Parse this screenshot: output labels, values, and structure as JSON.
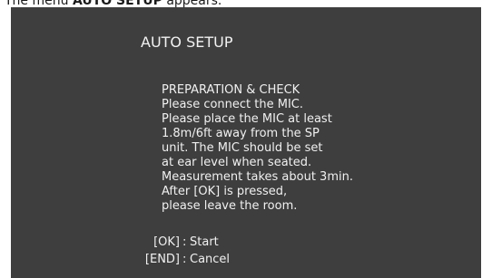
{
  "caption": {
    "prefix": "The menu ",
    "bold": "AUTO SETUP",
    "suffix": " appears."
  },
  "dialog": {
    "title": "AUTO SETUP",
    "lines": [
      "PREPARATION & CHECK",
      "Please connect the MIC.",
      "Please place the MIC at least",
      "1.8m/6ft away from the SP",
      "unit. The MIC should be set",
      "at ear level when seated.",
      "Measurement takes about 3min.",
      "After [OK] is pressed,",
      "please leave the room."
    ],
    "keys": [
      {
        "label": "[OK]",
        "sep": ":",
        "action": "Start"
      },
      {
        "label": "[END]",
        "sep": ":",
        "action": "Cancel"
      }
    ]
  },
  "colors": {
    "screen_bg": "#3e3e3e",
    "text": "#f0f0f0"
  }
}
